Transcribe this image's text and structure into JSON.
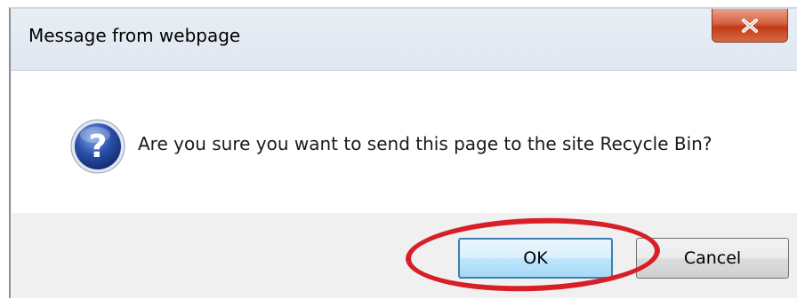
{
  "dialog": {
    "title": "Message from webpage",
    "message": "Are you sure you want to send this page to the site Recycle Bin?",
    "icon": "question-icon",
    "close_icon": "close-icon"
  },
  "buttons": {
    "ok_label": "OK",
    "cancel_label": "Cancel"
  },
  "annotation": {
    "shape": "ellipse",
    "target": "ok-button",
    "color": "#d71f28"
  },
  "colors": {
    "close_button": "#c13a17",
    "ok_border": "#3c7fb1",
    "question_icon": "#2a4fa8"
  }
}
